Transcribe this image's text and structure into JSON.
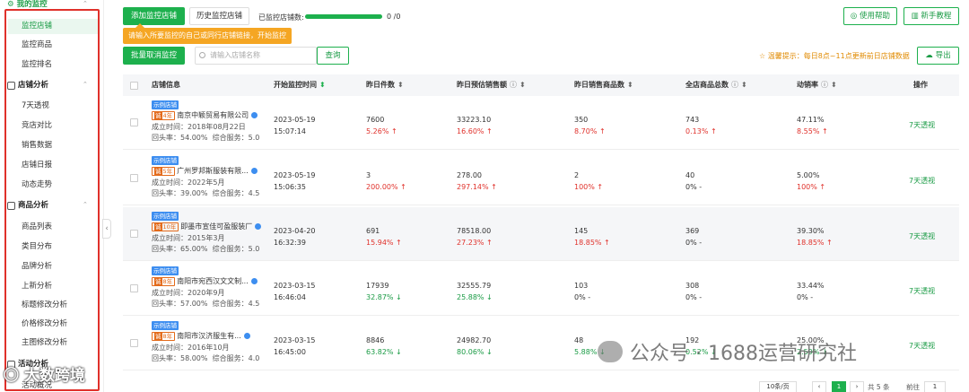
{
  "sidebar": {
    "sections": [
      {
        "title": "我的监控",
        "items": [
          "监控店铺",
          "监控商品",
          "监控排名"
        ]
      },
      {
        "title": "店铺分析",
        "items": [
          "7天透视",
          "竞店对比",
          "销售数据",
          "店铺日报",
          "动态走势"
        ]
      },
      {
        "title": "商品分析",
        "items": [
          "商品列表",
          "类目分布",
          "品牌分析",
          "上新分析",
          "标题修改分析",
          "价格修改分析",
          "主图修改分析"
        ]
      },
      {
        "title": "活动分析",
        "items": [
          "活动概况"
        ]
      }
    ],
    "active_item": "监控店铺"
  },
  "toolbar": {
    "add_button": "添加监控店铺",
    "history_button": "历史监控店铺",
    "monitored_count_label": "已监控店铺数:",
    "monitored_count_value": "0 /0",
    "batch_cancel_button": "批量取消监控",
    "search_placeholder": "请输入店铺名称",
    "query_button": "查询",
    "help_button": "使用帮助",
    "tutorial_button": "新手教程",
    "export_button": "导出",
    "tip": "温馨提示：每日8点~11点更新前日店铺数据",
    "tooltip": "请输入所要监控的自己或同行店铺链接，开始监控",
    "progress": 1.0
  },
  "table": {
    "headers": [
      "店铺信息",
      "开始监控时间",
      "昨日件数",
      "昨日预估销售额",
      "昨日销售商品数",
      "全店商品总数",
      "动销率",
      "操作"
    ],
    "rows": [
      {
        "tag": "示例店铺",
        "years": "4年",
        "name": "南京中颖贸易有限公司",
        "established": "成立时间：2018年08月22日",
        "returns": "回头率：54.00%",
        "service": "综合服务：5.0",
        "date": "2023-05-19",
        "time": "15:07:14",
        "units": "7600",
        "units_chg": "5.26% ↑",
        "units_dir": "up",
        "sales": "33223.10",
        "sales_chg": "16.60% ↑",
        "sales_dir": "up",
        "items": "350",
        "items_chg": "8.70% ↑",
        "items_dir": "up",
        "total": "743",
        "total_chg": "0.13% ↑",
        "total_dir": "up",
        "rate": "47.11%",
        "rate_chg": "8.55% ↑",
        "rate_dir": "up",
        "action": "7天透视"
      },
      {
        "tag": "示例店铺",
        "years": "5年",
        "name": "广州罗邦斯服装有限...",
        "established": "成立时间：2022年5月",
        "returns": "回头率：39.00%",
        "service": "综合服务：4.5",
        "date": "2023-05-19",
        "time": "15:06:35",
        "units": "3",
        "units_chg": "200.00% ↑",
        "units_dir": "up",
        "sales": "278.00",
        "sales_chg": "297.14% ↑",
        "sales_dir": "up",
        "items": "2",
        "items_chg": "100% ↑",
        "items_dir": "up",
        "total": "40",
        "total_chg": "0%  -",
        "total_dir": "flat",
        "rate": "5.00%",
        "rate_chg": "100% ↑",
        "rate_dir": "up",
        "action": "7天透视"
      },
      {
        "tag": "示例店铺",
        "years": "10年",
        "name": "即墨市宣佳可盈服装厂",
        "established": "成立时间：2015年3月",
        "returns": "回头率：65.00%",
        "service": "综合服务：5.0",
        "date": "2023-04-20",
        "time": "16:32:39",
        "units": "691",
        "units_chg": "15.94% ↑",
        "units_dir": "up",
        "sales": "78518.00",
        "sales_chg": "27.23% ↑",
        "sales_dir": "up",
        "items": "145",
        "items_chg": "18.85% ↑",
        "items_dir": "up",
        "total": "369",
        "total_chg": "0%  -",
        "total_dir": "flat",
        "rate": "39.30%",
        "rate_chg": "18.85% ↑",
        "rate_dir": "up",
        "action": "7天透视"
      },
      {
        "tag": "示例店铺",
        "years": "8年",
        "name": "南阳市宛西汉文文制...",
        "established": "成立时间：2020年9月",
        "returns": "回头率：57.00%",
        "service": "综合服务：4.5",
        "date": "2023-03-15",
        "time": "16:46:04",
        "units": "17939",
        "units_chg": "32.87% ↓",
        "units_dir": "down",
        "sales": "32555.79",
        "sales_chg": "25.88% ↓",
        "sales_dir": "down",
        "items": "103",
        "items_chg": "0%  -",
        "items_dir": "flat",
        "total": "308",
        "total_chg": "0%  -",
        "total_dir": "flat",
        "rate": "33.44%",
        "rate_chg": "0%  -",
        "rate_dir": "flat",
        "action": "7天透视"
      },
      {
        "tag": "示例店铺",
        "years": "8年",
        "name": "南阳市汉济服生有...",
        "established": "成立时间：2016年10月",
        "returns": "回头率：58.00%",
        "service": "综合服务：4.0",
        "date": "2023-03-15",
        "time": "16:45:00",
        "units": "8846",
        "units_chg": "63.82% ↓",
        "units_dir": "down",
        "sales": "24982.70",
        "sales_chg": "80.06% ↓",
        "sales_dir": "down",
        "items": "48",
        "items_chg": "5.88% ↓",
        "items_dir": "down",
        "total": "192",
        "total_chg": "0.52% ↓",
        "total_dir": "down",
        "rate": "25.00%",
        "rate_chg": "2.59% ↓",
        "rate_dir": "down",
        "action": "7天透视"
      }
    ]
  },
  "pagination": {
    "page_size": "10条/页",
    "current_page": "1",
    "total": "共 5 条",
    "goto_label": "前往",
    "goto_value": "1"
  },
  "watermark": {
    "right": "公众号 · 1688运营研究社",
    "left": "大数跨境"
  },
  "colors": {
    "accent": "#1db04d",
    "up": "#e0312b",
    "down": "#1a9b45",
    "highlight_border": "#e0312b"
  }
}
